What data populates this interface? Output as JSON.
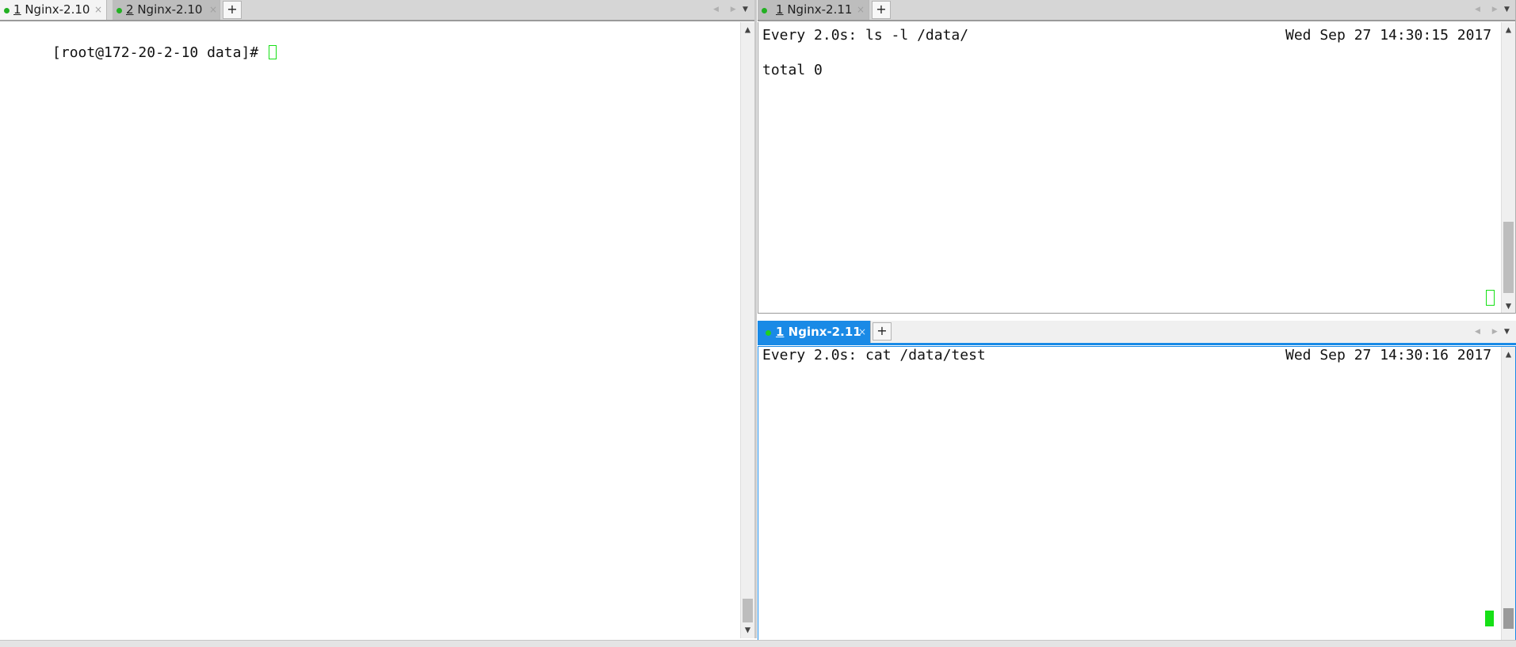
{
  "left_pane": {
    "tabs": [
      {
        "num": "1",
        "name": "Nginx-2.10",
        "close": "×"
      },
      {
        "num": "2",
        "name": "Nginx-2.10",
        "close": "×"
      }
    ],
    "add_tab": "+",
    "nav_arrows": "◀ ▶",
    "menu_arrow": "▼",
    "terminal": {
      "prompt": "[root@172-20-2-10 data]# "
    }
  },
  "right_top_pane": {
    "tabs": [
      {
        "num": "1",
        "name": "Nginx-2.11",
        "close": "×"
      }
    ],
    "add_tab": "+",
    "nav_arrows": "◀ ▶",
    "menu_arrow": "▼",
    "terminal": {
      "header_left": "Every 2.0s: ls -l /data/",
      "header_right": "Wed Sep 27 14:30:15 2017",
      "output": "total 0"
    }
  },
  "right_bottom_pane": {
    "tabs": [
      {
        "num": "1",
        "name": "Nginx-2.11",
        "close": "×"
      }
    ],
    "add_tab": "+",
    "nav_arrows": "◀ ▶",
    "menu_arrow": "▼",
    "terminal": {
      "header_left": "Every 2.0s: cat /data/test",
      "header_right": "Wed Sep 27 14:30:16 2017"
    }
  },
  "scroll": {
    "up": "▲",
    "down": "▼"
  },
  "colors": {
    "active_tab": "#1a8ae6",
    "cursor": "#16e016",
    "status_dot": "#22b022"
  }
}
